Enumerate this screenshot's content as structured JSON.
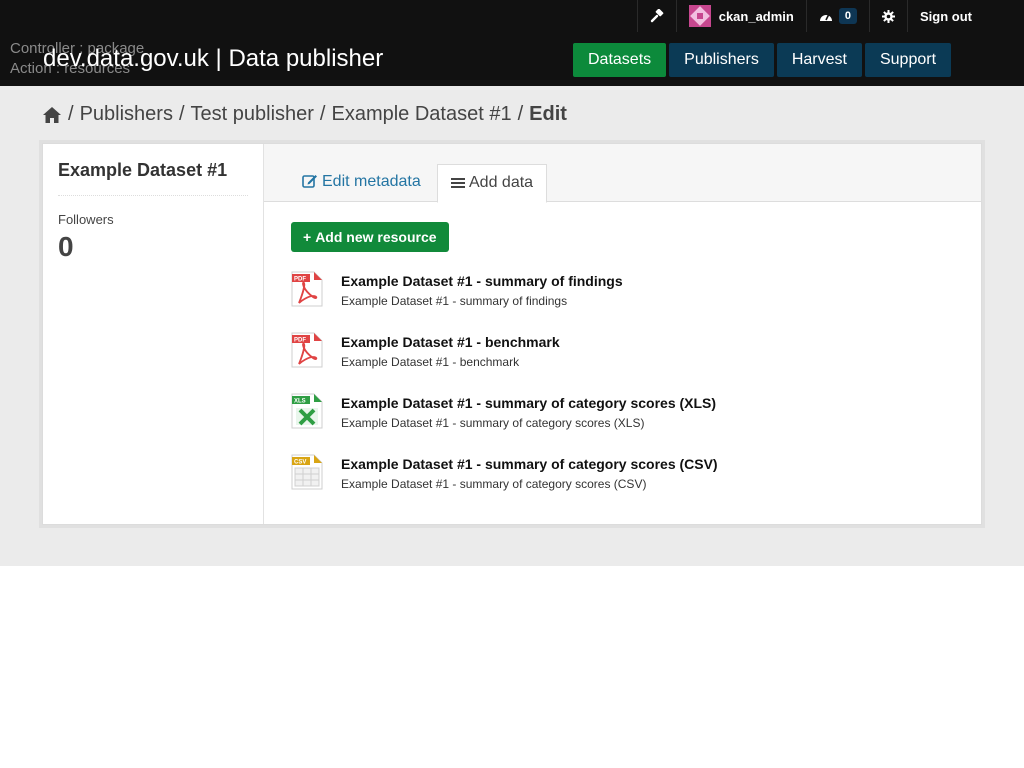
{
  "header": {
    "site_title": "dev.data.gov.uk | Data publisher",
    "debug_controller": "Controller : package",
    "debug_action": "Action : resources",
    "account": {
      "username": "ckan_admin",
      "dashboard_count": "0",
      "sign_out": "Sign out",
      "icons": [
        "hammer-icon",
        "avatar",
        "dashboard-icon",
        "gear-icon"
      ]
    },
    "nav": [
      {
        "label": "Datasets",
        "active": true
      },
      {
        "label": "Publishers",
        "active": false
      },
      {
        "label": "Harvest",
        "active": false
      },
      {
        "label": "Support",
        "active": false
      }
    ],
    "colors": {
      "nav_active": "#0c8a3b",
      "nav": "#0b3a55",
      "bar": "#111111"
    }
  },
  "breadcrumb": {
    "items": [
      "Publishers",
      "Test publisher",
      "Example Dataset #1"
    ],
    "current": "Edit",
    "separator": "/"
  },
  "sidebar": {
    "title": "Example Dataset #1",
    "followers_label": "Followers",
    "followers_count": "0"
  },
  "tabs": [
    {
      "label": "Edit metadata",
      "icon": "edit-icon",
      "active": false
    },
    {
      "label": "Add data",
      "icon": "list-icon",
      "active": true
    }
  ],
  "add_button": {
    "label": "Add new resource",
    "icon": "plus-icon"
  },
  "resources": [
    {
      "format": "PDF",
      "title": "Example Dataset #1 - summary of findings",
      "description": "Example Dataset #1 - summary of findings"
    },
    {
      "format": "PDF",
      "title": "Example Dataset #1 - benchmark",
      "description": "Example Dataset #1 - benchmark"
    },
    {
      "format": "XLS",
      "title": "Example Dataset #1 - summary of category scores (XLS)",
      "description": "Example Dataset #1 - summary of category scores (XLS)"
    },
    {
      "format": "CSV",
      "title": "Example Dataset #1 - summary of category scores (CSV)",
      "description": "Example Dataset #1 - summary of category scores (CSV)"
    }
  ]
}
